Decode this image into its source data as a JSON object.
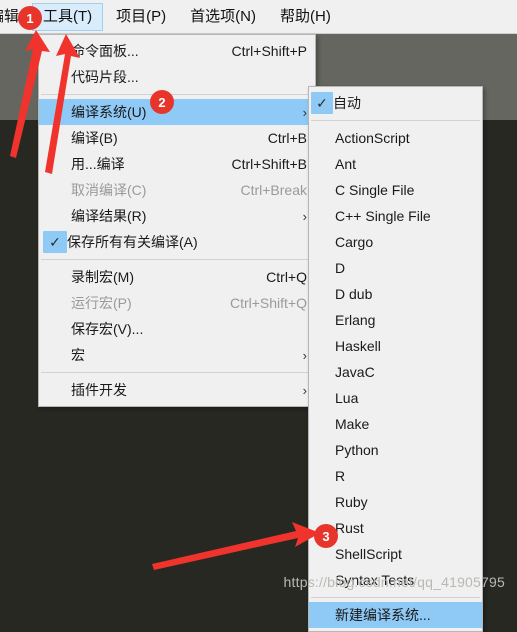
{
  "colors": {
    "menu_background": "#f0f0f0",
    "highlight_blue": "#8fc9f5",
    "badge_red": "#e8352b",
    "arrow_red": "#f0332c",
    "app_dark": "#272822",
    "app_gray": "#666660",
    "disabled_text": "#9a9a9a"
  },
  "menubar": {
    "items": [
      {
        "label": "编辑",
        "clipped": true,
        "active": false
      },
      {
        "label": "工具(T)",
        "active": true
      },
      {
        "label": "项目(P)",
        "active": false
      },
      {
        "label": "首选项(N)",
        "active": false
      },
      {
        "label": "帮助(H)",
        "active": false
      }
    ]
  },
  "tools_menu": {
    "rows": [
      {
        "type": "item",
        "label": "命令面板...",
        "accel": "Ctrl+Shift+P",
        "submenu": false,
        "checked": false,
        "disabled": false,
        "highlight": false
      },
      {
        "type": "item",
        "label": "代码片段...",
        "accel": "",
        "submenu": false,
        "checked": false,
        "disabled": false,
        "highlight": false
      },
      {
        "type": "separator"
      },
      {
        "type": "item",
        "label": "编译系统(U)",
        "accel": "",
        "submenu": true,
        "checked": false,
        "disabled": false,
        "highlight": true
      },
      {
        "type": "item",
        "label": "编译(B)",
        "accel": "Ctrl+B",
        "submenu": false,
        "checked": false,
        "disabled": false,
        "highlight": false
      },
      {
        "type": "item",
        "label": "用...编译",
        "accel": "Ctrl+Shift+B",
        "submenu": false,
        "checked": false,
        "disabled": false,
        "highlight": false
      },
      {
        "type": "item",
        "label": "取消编译(C)",
        "accel": "Ctrl+Break",
        "submenu": false,
        "checked": false,
        "disabled": true,
        "highlight": false
      },
      {
        "type": "item",
        "label": "编译结果(R)",
        "accel": "",
        "submenu": true,
        "checked": false,
        "disabled": false,
        "highlight": false
      },
      {
        "type": "item",
        "label": "保存所有有关编译(A)",
        "accel": "",
        "submenu": false,
        "checked": true,
        "disabled": false,
        "highlight": false
      },
      {
        "type": "separator"
      },
      {
        "type": "item",
        "label": "录制宏(M)",
        "accel": "Ctrl+Q",
        "submenu": false,
        "checked": false,
        "disabled": false,
        "highlight": false
      },
      {
        "type": "item",
        "label": "运行宏(P)",
        "accel": "Ctrl+Shift+Q",
        "submenu": false,
        "checked": false,
        "disabled": true,
        "highlight": false
      },
      {
        "type": "item",
        "label": "保存宏(V)...",
        "accel": "",
        "submenu": false,
        "checked": false,
        "disabled": false,
        "highlight": false
      },
      {
        "type": "item",
        "label": "宏",
        "accel": "",
        "submenu": true,
        "checked": false,
        "disabled": false,
        "highlight": false
      },
      {
        "type": "separator"
      },
      {
        "type": "item",
        "label": "插件开发",
        "accel": "",
        "submenu": true,
        "checked": false,
        "disabled": false,
        "highlight": false
      }
    ]
  },
  "build_system_submenu": {
    "rows": [
      {
        "type": "item",
        "label": "自动",
        "checked": true,
        "highlight": false
      },
      {
        "type": "separator"
      },
      {
        "type": "item",
        "label": "ActionScript",
        "checked": false,
        "highlight": false
      },
      {
        "type": "item",
        "label": "Ant",
        "checked": false,
        "highlight": false
      },
      {
        "type": "item",
        "label": "C Single File",
        "checked": false,
        "highlight": false
      },
      {
        "type": "item",
        "label": "C++ Single File",
        "checked": false,
        "highlight": false
      },
      {
        "type": "item",
        "label": "Cargo",
        "checked": false,
        "highlight": false
      },
      {
        "type": "item",
        "label": "D",
        "checked": false,
        "highlight": false
      },
      {
        "type": "item",
        "label": "D dub",
        "checked": false,
        "highlight": false
      },
      {
        "type": "item",
        "label": "Erlang",
        "checked": false,
        "highlight": false
      },
      {
        "type": "item",
        "label": "Haskell",
        "checked": false,
        "highlight": false
      },
      {
        "type": "item",
        "label": "JavaC",
        "checked": false,
        "highlight": false
      },
      {
        "type": "item",
        "label": "Lua",
        "checked": false,
        "highlight": false
      },
      {
        "type": "item",
        "label": "Make",
        "checked": false,
        "highlight": false
      },
      {
        "type": "item",
        "label": "Python",
        "checked": false,
        "highlight": false
      },
      {
        "type": "item",
        "label": "R",
        "checked": false,
        "highlight": false
      },
      {
        "type": "item",
        "label": "Ruby",
        "checked": false,
        "highlight": false
      },
      {
        "type": "item",
        "label": "Rust",
        "checked": false,
        "highlight": false
      },
      {
        "type": "item",
        "label": "ShellScript",
        "checked": false,
        "highlight": false
      },
      {
        "type": "item",
        "label": "Syntax Tests",
        "checked": false,
        "highlight": false
      },
      {
        "type": "separator"
      },
      {
        "type": "item",
        "label": "新建编译系统...",
        "checked": false,
        "highlight": true
      }
    ]
  },
  "annotations": {
    "badges": [
      {
        "id": "badge-1",
        "number": "1"
      },
      {
        "id": "badge-2",
        "number": "2"
      },
      {
        "id": "badge-3",
        "number": "3"
      }
    ]
  },
  "watermark": {
    "text": "https://blog.csdn.net/qq_41905795"
  },
  "glyphs": {
    "check": "✓",
    "submenu_arrow": "›"
  }
}
